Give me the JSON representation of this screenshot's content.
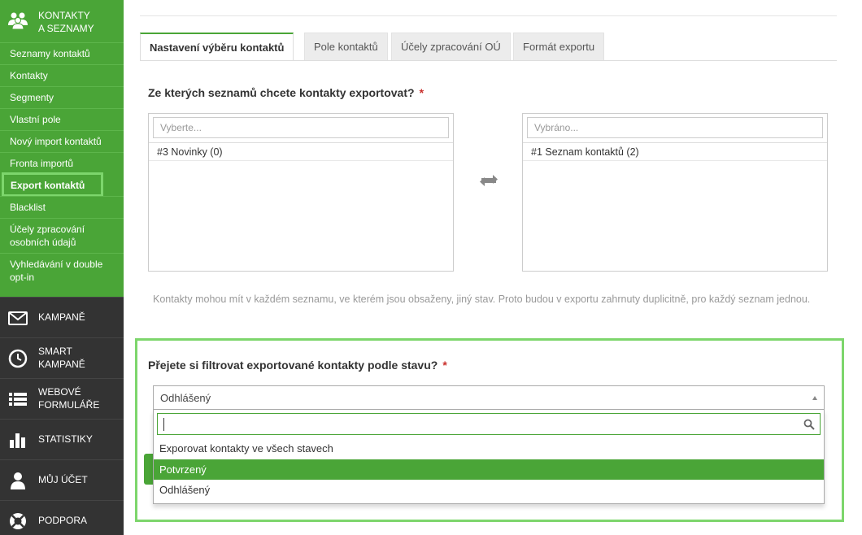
{
  "sidebar": {
    "header": {
      "icon": "contacts-icon",
      "line1": "KONTAKTY",
      "line2": "A SEZNAMY"
    },
    "sub_items": [
      {
        "label": "Seznamy kontaktů"
      },
      {
        "label": "Kontakty"
      },
      {
        "label": "Segmenty"
      },
      {
        "label": "Vlastní pole"
      },
      {
        "label": "Nový import kontaktů"
      },
      {
        "label": "Fronta importů"
      },
      {
        "label": "Export kontaktů",
        "active": true
      },
      {
        "label": "Blacklist"
      },
      {
        "line1": "Účely zpracování",
        "line2": "osobních údajů"
      },
      {
        "line1": "Vyhledávání v double",
        "line2": "opt-in"
      }
    ],
    "main_items": [
      {
        "icon": "envelope-icon",
        "line1": "KAMPANĚ"
      },
      {
        "icon": "clock-icon",
        "line1": "SMART",
        "line2": "KAMPANĚ"
      },
      {
        "icon": "list-icon",
        "line1": "WEBOVÉ",
        "line2": "FORMULÁŘE"
      },
      {
        "icon": "bar-chart-icon",
        "line1": "STATISTIKY"
      },
      {
        "icon": "user-icon",
        "line1": "MŮJ ÚČET"
      },
      {
        "icon": "lifebuoy-icon",
        "line1": "PODPORA"
      }
    ]
  },
  "tabs": [
    {
      "label": "Nastavení výběru kontaktů",
      "active": true
    },
    {
      "label": "Pole kontaktů"
    },
    {
      "label": "Účely zpracování OÚ"
    },
    {
      "label": "Formát exportu"
    }
  ],
  "lists_section": {
    "question": "Ze kterých seznamů chcete kontakty exportovat?",
    "required_mark": "*",
    "available": {
      "placeholder": "Vyberte...",
      "items": [
        "#3 Novinky (0)"
      ]
    },
    "selected": {
      "placeholder": "Vybráno...",
      "items": [
        "#1 Seznam kontaktů (2)"
      ]
    },
    "swap_icon": "swap-arrows-icon",
    "hint": "Kontakty mohou mít v každém seznamu, ve kterém jsou obsaženy, jiný stav. Proto budou v exportu zahrnuty duplicitně, pro každý seznam jednou."
  },
  "filter_section": {
    "question": "Přejete si filtrovat exportované kontakty podle stavu?",
    "required_mark": "*",
    "selected_value": "Odhlášený",
    "search_icon": "search-icon",
    "options": [
      {
        "label": "Exporovat kontakty ve všech stavech"
      },
      {
        "label": "Potvrzený",
        "highlighted": true
      },
      {
        "label": "Odhlášený"
      }
    ]
  },
  "colors": {
    "brand_green": "#4aa537",
    "sidebar_dark": "#333333",
    "annotation_green": "#7dd66c",
    "required_red": "#c9302c"
  }
}
